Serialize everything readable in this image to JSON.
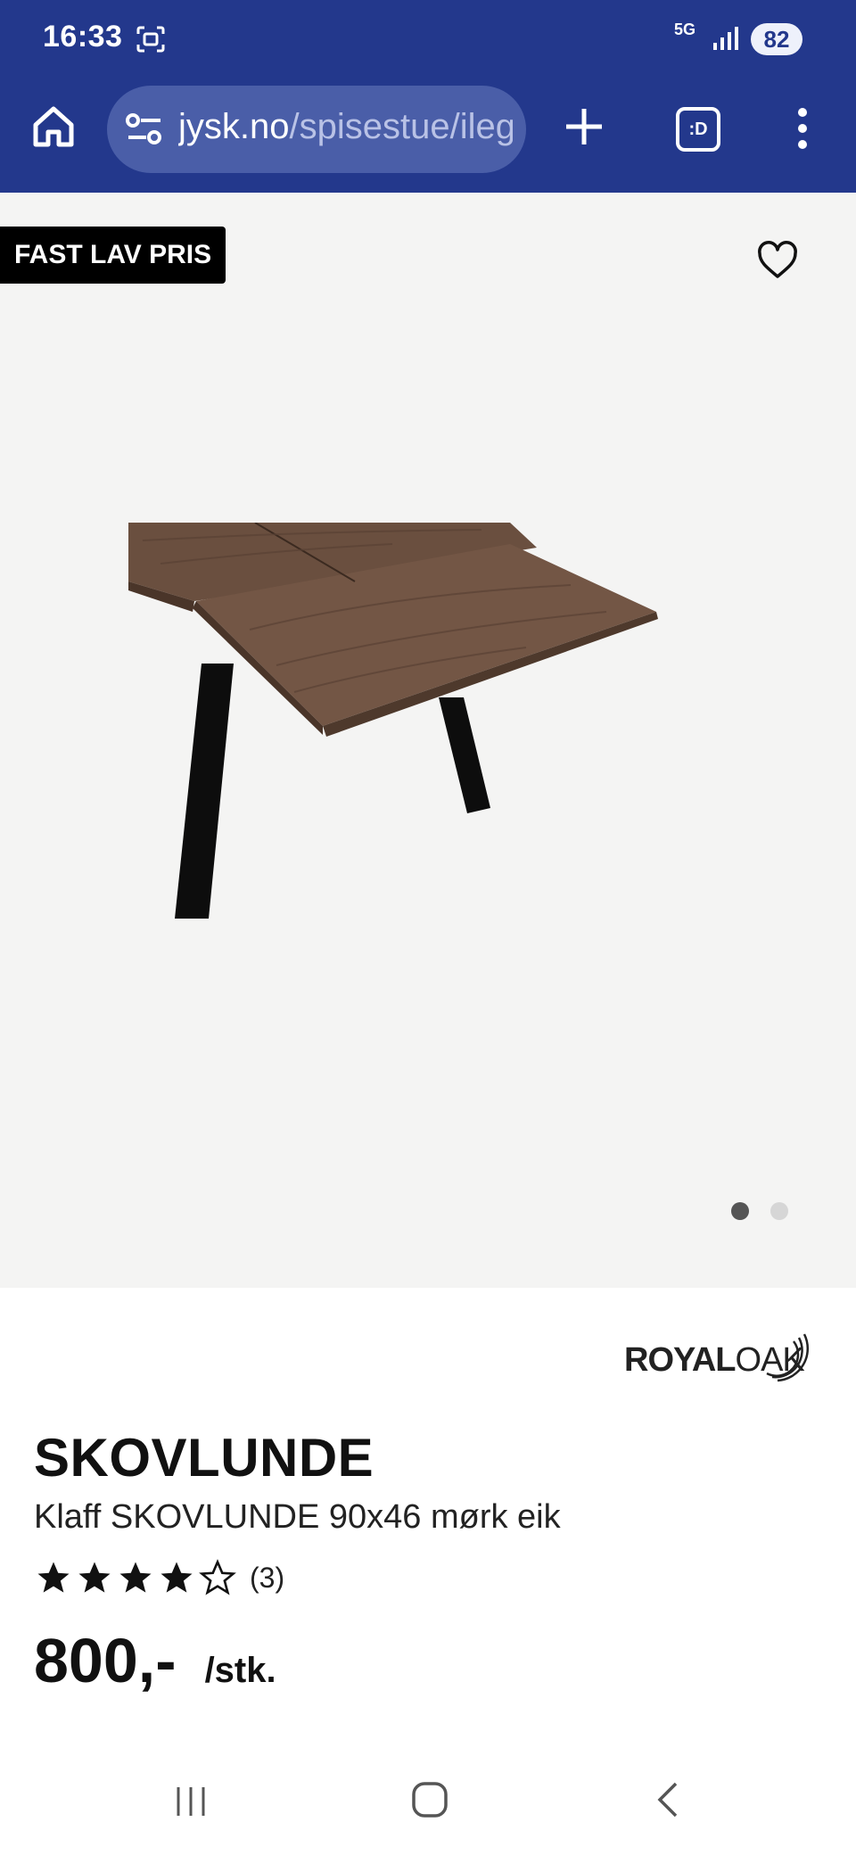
{
  "status_bar": {
    "time": "16:33",
    "network": "5G",
    "battery": "82"
  },
  "browser": {
    "url_domain": "jysk.no",
    "url_path": "/spisestue/ileg",
    "tabs_label": ":D"
  },
  "product": {
    "badge": "FAST LAV PRIS",
    "brand_logo_text": "ROYALOAK",
    "brand_bold": "ROYAL",
    "brand_light": "OAK",
    "name": "SKOVLUNDE",
    "description": "Klaff SKOVLUNDE 90x46 mørk eik",
    "rating": 4,
    "rating_max": 5,
    "review_count": "(3)",
    "price": "800,-",
    "price_unit": "/stk."
  },
  "gallery": {
    "image_count": 2,
    "active_index": 0
  },
  "colors": {
    "brand_blue": "#23388c",
    "url_bar": "#4a5ea8",
    "image_bg": "#f4f4f3",
    "wood": "#6b5243"
  },
  "icons": {
    "home": "home-icon",
    "site_settings": "tune-icon",
    "new_tab": "plus-icon",
    "tabs": "tabs-icon",
    "menu": "more-vert-icon",
    "favorite": "heart-icon"
  }
}
